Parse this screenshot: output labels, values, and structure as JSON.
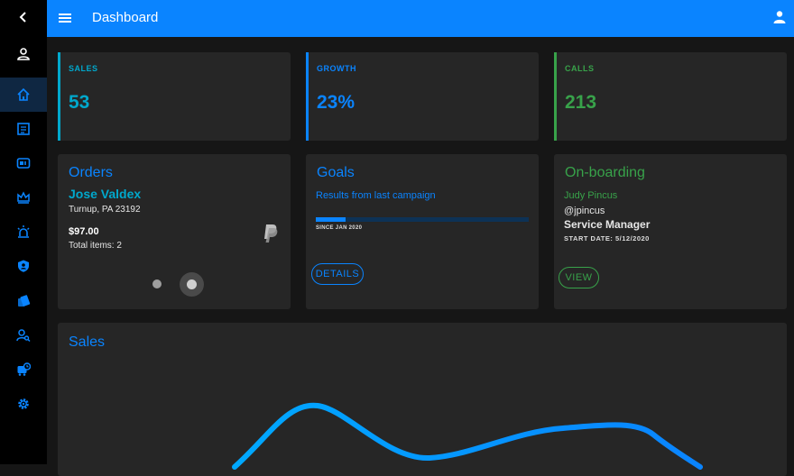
{
  "topbar": {
    "title": "Dashboard"
  },
  "colors": {
    "blue": "#0a84ff",
    "teal": "#00a8cc",
    "green": "#38a24a",
    "bg": "#161616",
    "card": "#262626"
  },
  "sidebar": {
    "items": [
      {
        "name": "back",
        "icon": "chevron-left-icon"
      },
      {
        "name": "account",
        "icon": "user-icon"
      },
      {
        "name": "home",
        "icon": "home-icon"
      },
      {
        "name": "documents",
        "icon": "document-icon"
      },
      {
        "name": "inbox",
        "icon": "inbox-icon"
      },
      {
        "name": "crown",
        "icon": "crown-icon"
      },
      {
        "name": "alerts",
        "icon": "siren-icon"
      },
      {
        "name": "security",
        "icon": "shield-icon"
      },
      {
        "name": "cards",
        "icon": "cards-icon"
      },
      {
        "name": "search-users",
        "icon": "user-search-icon"
      },
      {
        "name": "bus",
        "icon": "bus-icon"
      },
      {
        "name": "settings",
        "icon": "gear-icon"
      }
    ]
  },
  "stats": {
    "sales": {
      "label": "SALES",
      "value": "53"
    },
    "growth": {
      "label": "GROWTH",
      "value": "23%"
    },
    "calls": {
      "label": "CALLS",
      "value": "213"
    }
  },
  "orders": {
    "title": "Orders",
    "name": "Jose Valdex",
    "address": "Turnup, PA 23192",
    "amount": "$97.00",
    "items": "Total items: 2"
  },
  "goals": {
    "title": "Goals",
    "subtitle": "Results from last campaign",
    "progress": 0.14,
    "since": "SINCE JAN 2020",
    "button": "DETAILS"
  },
  "onboarding": {
    "title": "On-boarding",
    "name": "Judy Pincus",
    "handle": "@jpincus",
    "role": "Service Manager",
    "start": "START DATE: 5/12/2020",
    "button": "VIEW"
  },
  "sales_chart": {
    "title": "Sales"
  }
}
